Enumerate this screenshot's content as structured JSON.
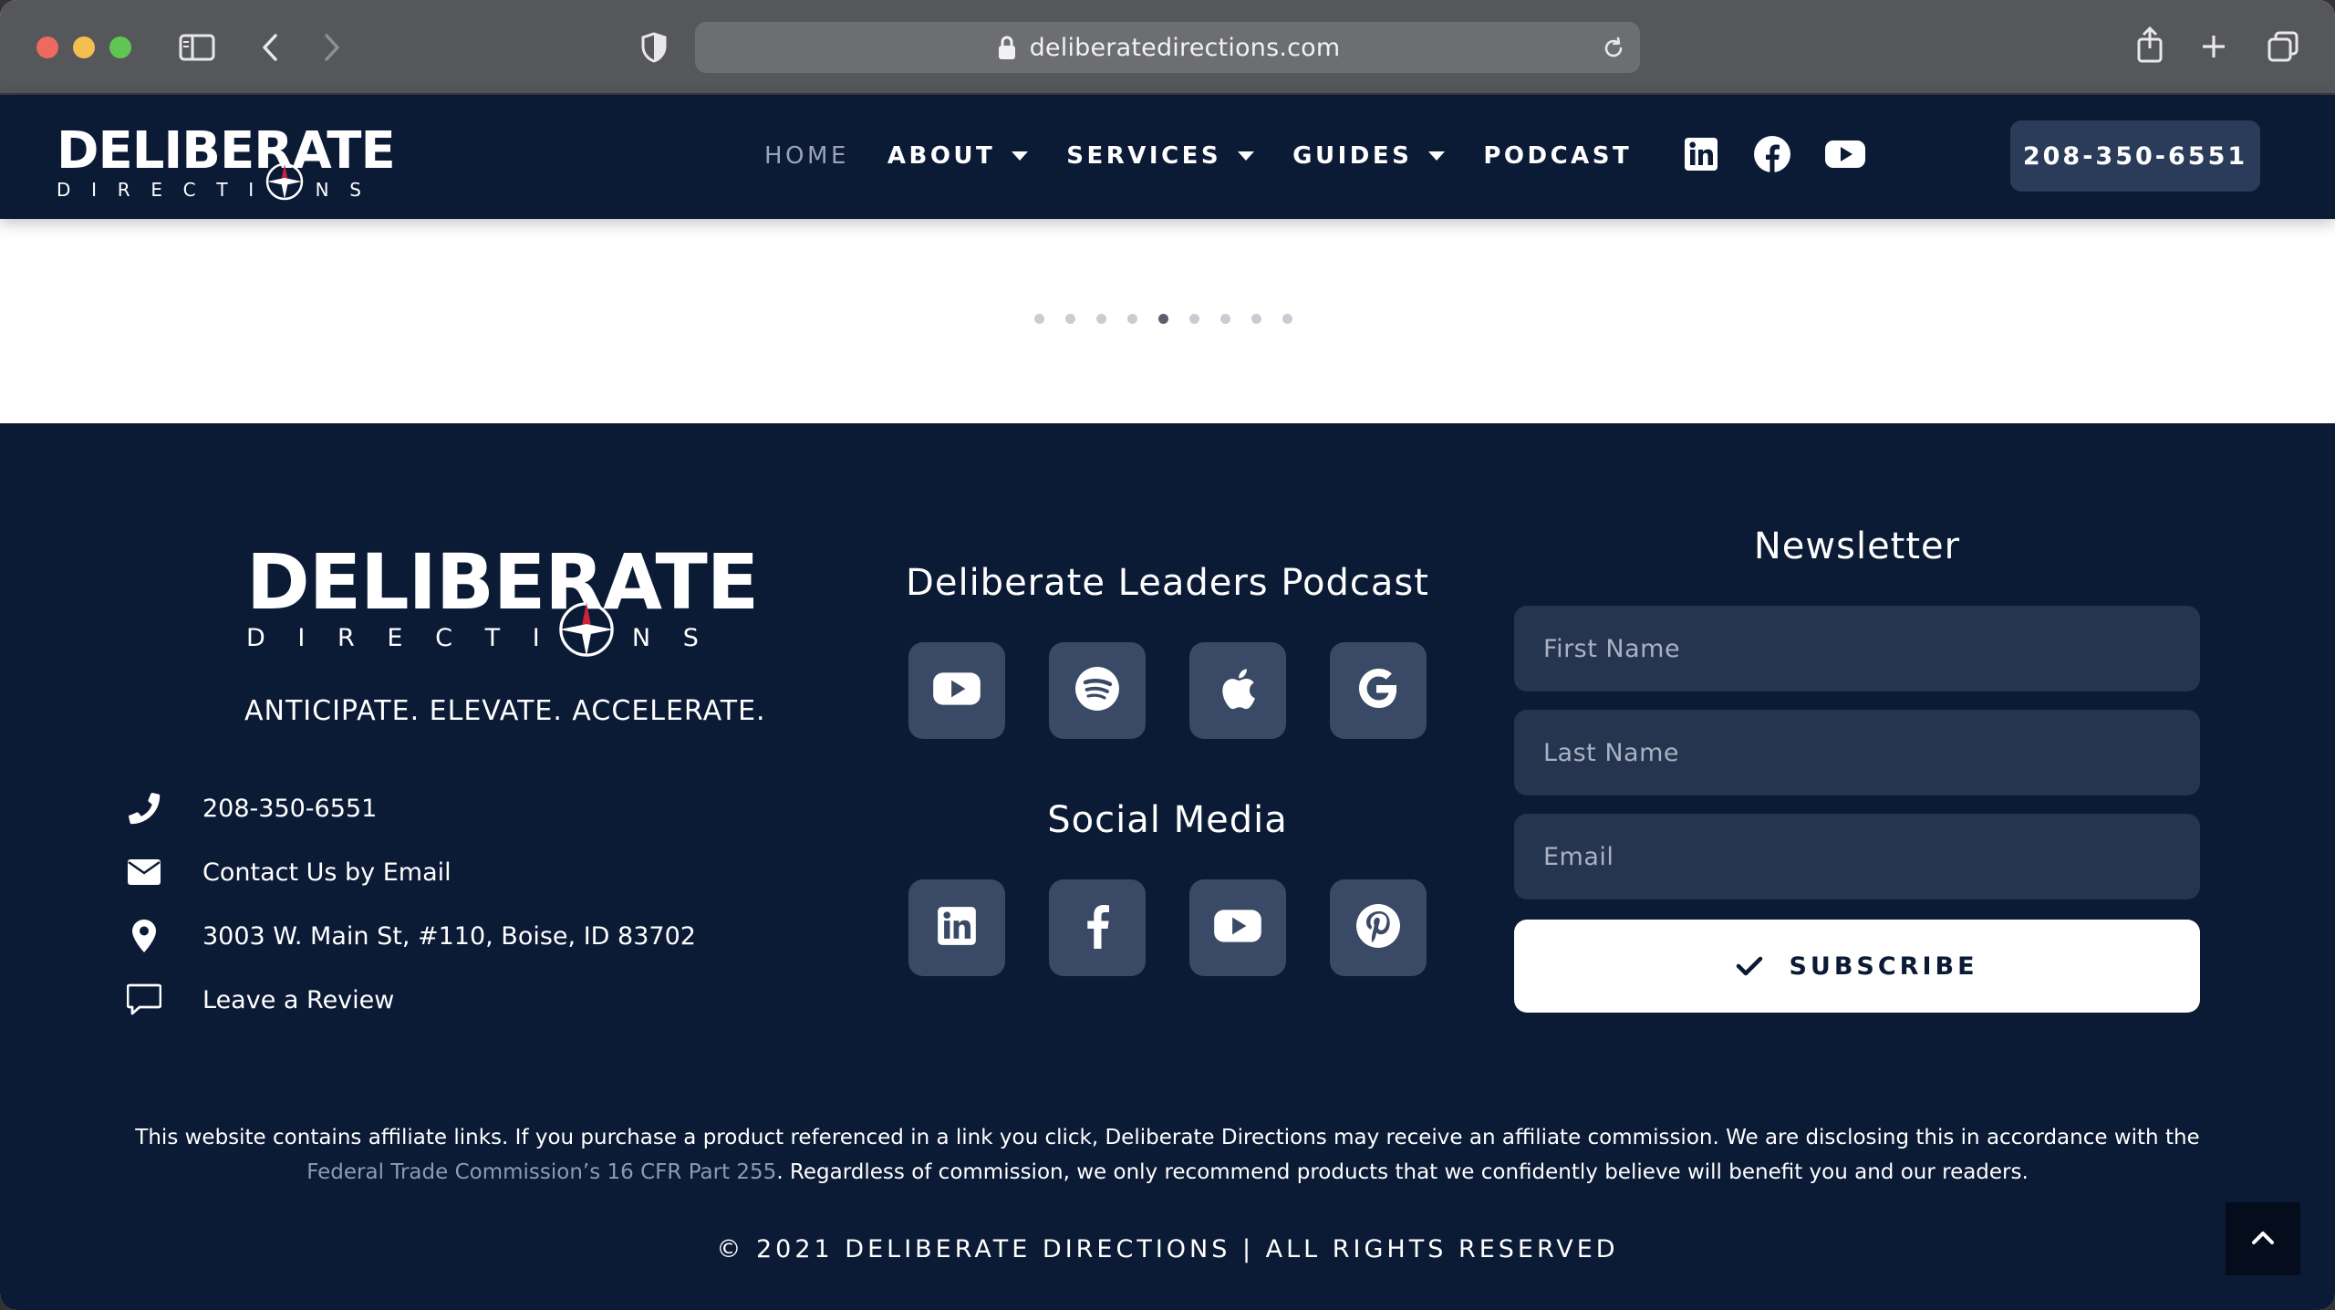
{
  "browser": {
    "url": "deliberatedirections.com"
  },
  "header": {
    "logo": {
      "main": "DELIBERATE",
      "sub": [
        "D",
        "I",
        "R",
        "E",
        "C",
        "T",
        "I",
        "O",
        "N",
        "S"
      ]
    },
    "nav": [
      {
        "label": "HOME",
        "active": true,
        "dropdown": false
      },
      {
        "label": "ABOUT",
        "active": false,
        "dropdown": true
      },
      {
        "label": "SERVICES",
        "active": false,
        "dropdown": true
      },
      {
        "label": "GUIDES",
        "active": false,
        "dropdown": true
      },
      {
        "label": "PODCAST",
        "active": false,
        "dropdown": false
      }
    ],
    "social_icons": [
      "linkedin-icon",
      "facebook-icon",
      "youtube-icon"
    ],
    "phone_button": "208-350-6551"
  },
  "carousel": {
    "dot_count": 9,
    "active_index": 4
  },
  "footer": {
    "logo": {
      "main": "DELIBERATE",
      "sub": [
        "D",
        "I",
        "R",
        "E",
        "C",
        "T",
        "I",
        "O",
        "N",
        "S"
      ]
    },
    "tagline": "ANTICIPATE. ELEVATE. ACCELERATE.",
    "contacts": [
      {
        "icon": "phone-icon",
        "text": "208-350-6551"
      },
      {
        "icon": "envelope-icon",
        "text": "Contact Us by Email"
      },
      {
        "icon": "map-pin-icon",
        "text": "3003 W. Main St, #110, Boise, ID 83702"
      },
      {
        "icon": "comment-icon",
        "text": "Leave a Review"
      }
    ],
    "podcast_title": "Deliberate Leaders Podcast",
    "podcast_icons": [
      "youtube-icon",
      "spotify-icon",
      "apple-icon",
      "google-icon"
    ],
    "social_title": "Social Media",
    "social_icons": [
      "linkedin-icon",
      "facebook-icon",
      "youtube-icon",
      "pinterest-icon"
    ],
    "newsletter": {
      "title": "Newsletter",
      "first_name_placeholder": "First Name",
      "last_name_placeholder": "Last Name",
      "email_placeholder": "Email",
      "subscribe_label": "SUBSCRIBE"
    },
    "disclaimer": {
      "part1": "This website contains affiliate links. If you purchase a product referenced in a link you click, Deliberate Directions may receive an affiliate commission. We are disclosing this in accordance with the ",
      "link": "Federal Trade Commission’s 16 CFR Part 255",
      "part2": ". Regardless of commission, we only recommend products that we confidently believe will benefit you and our readers."
    },
    "copyright": "© 2021 DELIBERATE DIRECTIONS | ALL RIGHTS RESERVED"
  },
  "colors": {
    "navy": "#0b1a35",
    "tile": "#3a4a66",
    "field": "#25344f",
    "accent_red": "#c8243a"
  }
}
